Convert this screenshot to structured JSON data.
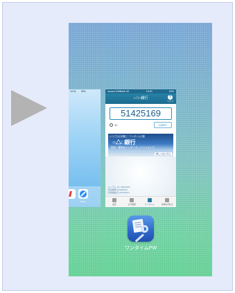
{
  "app_switcher": {
    "left_card": {
      "status_text": "10:01",
      "battery_text": "99%",
      "dock_labels": [
        "",
        "Safari"
      ]
    },
    "center_card": {
      "status_left": "●●●●● SoftBank 4G",
      "status_time": "18:30",
      "status_right": "84%",
      "header_title": "○△□銀行",
      "help_label": "ヘルプ",
      "help_icon_text": "?",
      "otp": "51425169",
      "timer_text": "12",
      "copy_label": "COPY",
      "banner": {
        "top_text": "いつでもお手軽に！ワンタイム口座",
        "title": "○△□銀行",
        "subtitle": "安全・便利なインターネットバンキング",
        "detail_label": "詳しくはこちら"
      },
      "footer_info": [
        "シリアル No. 00000000",
        "有効期限 2018/08/24",
        "利用開始日 2015/06/24"
      ],
      "tabs": [
        {
          "label": "設定",
          "active": false
        },
        {
          "label": "ログ履歴",
          "active": false
        },
        {
          "label": "ワンタイム",
          "active": true
        },
        {
          "label": "各種お手続き",
          "active": false
        }
      ]
    },
    "app": {
      "label": "ワンタイムPW"
    }
  },
  "colors": {
    "frame_bg": "#e6ebfb",
    "arrow": "#b3b3b3",
    "bank_header": "#1b6a8e",
    "otp_text": "#1a5d8a"
  }
}
